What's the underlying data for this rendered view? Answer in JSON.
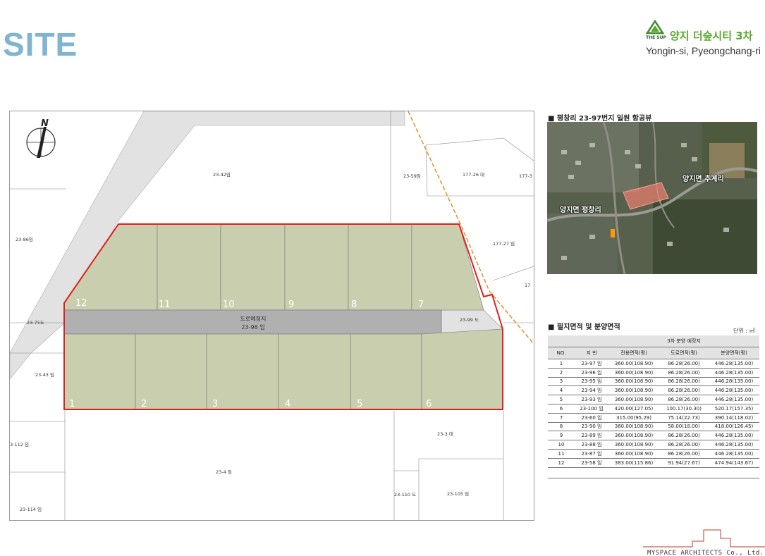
{
  "header": {
    "title": "SITE",
    "brand_logo_text": "THE SUP",
    "brand_name": "양지 더숲시티 3차",
    "brand_location": "Yongin-si, Pyeongchang-ri"
  },
  "site_plan": {
    "north": "N",
    "road_label": "도로예정지",
    "road_parcel": "23-98 임",
    "lot_numbers_top": [
      "12",
      "11",
      "10",
      "9",
      "8",
      "7"
    ],
    "lot_numbers_bottom": [
      "1",
      "2",
      "3",
      "4",
      "5",
      "6"
    ],
    "parcels": {
      "p23_42": "23-42임",
      "p23_59": "23-59임",
      "p177_26": "177-26 대",
      "p177_3": "177-3",
      "p23_86": "23-86임",
      "p177_27": "177-27 임",
      "p17": "17",
      "p23_75": "23-75도",
      "p23_99": "23-99 도",
      "p23_43": "23-43 임",
      "p3_112": "3-112 임",
      "p23_3": "23-3 대",
      "p23_4": "23-4 임",
      "p23_110": "23-110 도",
      "p23_105": "23-105 임",
      "p23_114": "23-114 임"
    }
  },
  "aerial": {
    "heading": "■ 평창리 23-97번지 일원 항공뷰",
    "label_east": "양지면 추계리",
    "label_west": "양지면 평창리"
  },
  "area_table": {
    "heading": "■ 필지면적 및 분양면적",
    "unit": "단위 : ㎡",
    "group_header": "3차 분양 예정지",
    "columns": [
      "NO.",
      "지 번",
      "전용면적(평)",
      "도로면적(평)",
      "분양면적(평)"
    ],
    "rows": [
      [
        "1",
        "23-97 임",
        "360.00(108.90)",
        "86.28(26.00)",
        "446.28(135.00)"
      ],
      [
        "2",
        "23-96 임",
        "360.00(108.90)",
        "86.28(26.00)",
        "446.28(135.00)"
      ],
      [
        "3",
        "23-95 임",
        "360.00(108.90)",
        "86.28(26.00)",
        "446.28(135.00)"
      ],
      [
        "4",
        "23-94 임",
        "360.00(108.90)",
        "86.28(26.00)",
        "446.28(135.00)"
      ],
      [
        "5",
        "23-93 임",
        "360.00(108.90)",
        "86.28(26.00)",
        "446.28(135.00)"
      ],
      [
        "6",
        "23-100 임",
        "420.00(127.05)",
        "100.17(30.30)",
        "520.17(157.35)"
      ],
      [
        "7",
        "23-60 임",
        "315.00(95.29)",
        "75.14(22.73)",
        "390.14(118.02)"
      ],
      [
        "8",
        "23-90 임",
        "360.00(108.90)",
        "58.00(18.00)",
        "418.00(126.45)"
      ],
      [
        "9",
        "23-89 임",
        "360.00(108.90)",
        "86.28(26.00)",
        "446.28(135.00)"
      ],
      [
        "10",
        "23-88 임",
        "360.00(108.90)",
        "86.28(26.00)",
        "446.28(135.00)"
      ],
      [
        "11",
        "23-87 임",
        "360.00(108.90)",
        "86.28(26.00)",
        "446.28(135.00)"
      ],
      [
        "12",
        "23-58 임",
        "383.00(115.86)",
        "91.94(27.67)",
        "474.94(143.67)"
      ]
    ]
  },
  "footer": {
    "firm": "MYSPACE ARCHITECTS Co., Ltd."
  },
  "colors": {
    "title": "#7fb5cf",
    "brand": "#5aa82e",
    "lot_fill": "#c9cfae",
    "road_fill": "#b0b0b0",
    "boundary": "#e02020",
    "access_road": "#e2e2e2"
  }
}
